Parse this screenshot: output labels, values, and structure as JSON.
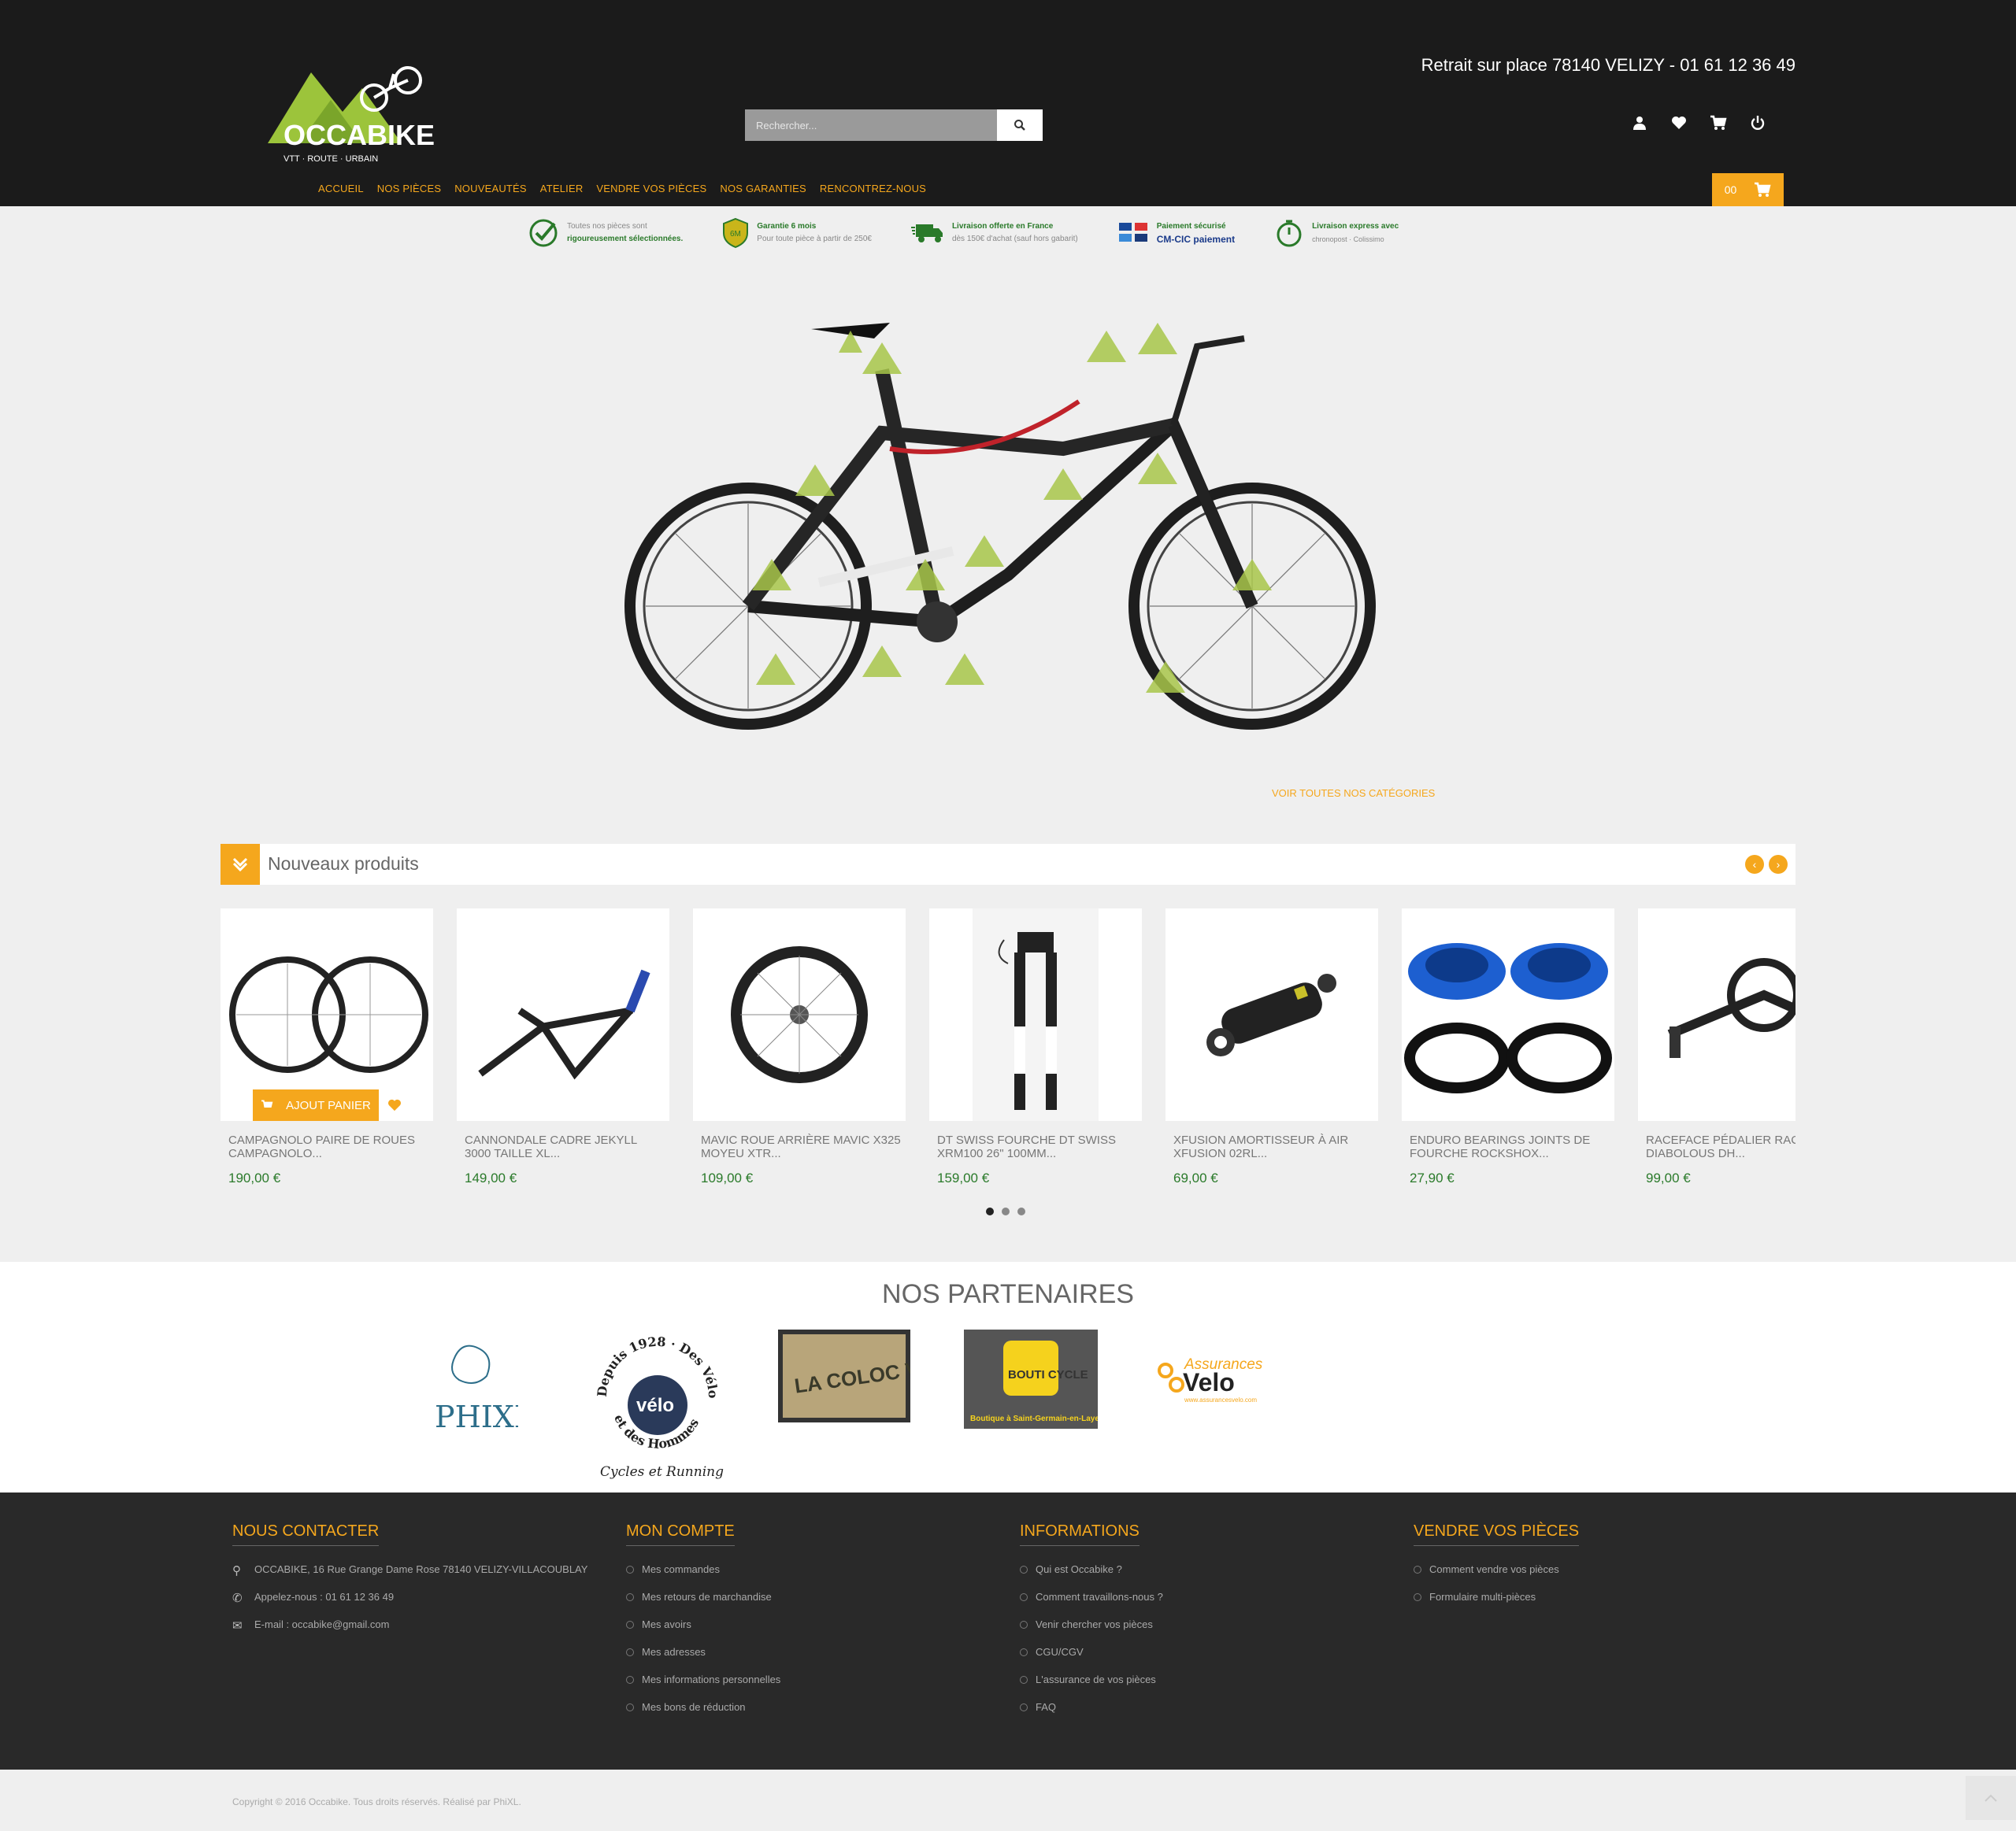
{
  "header": {
    "logo_text": "OCCABIKE",
    "logo_tagline": "VTT · ROUTE · URBAIN",
    "pickup": "Retrait sur place 78140 VELIZY - 01 61 12 36 49",
    "search_placeholder": "Rechercher..."
  },
  "nav": [
    "ACCUEIL",
    "NOS PIÈCES",
    "NOUVEAUTÉS",
    "ATELIER",
    "VENDRE VOS PIÈCES",
    "NOS GARANTIES",
    "RENCONTREZ-NOUS"
  ],
  "cart_count": "00",
  "reassurance": [
    {
      "line1": "Toutes nos pièces sont",
      "line2": "rigoureusement sélectionnées."
    },
    {
      "line1": "Garantie 6 mois",
      "line2": "Pour toute pièce à partir de 250€"
    },
    {
      "line1": "Livraison offerte en France",
      "line2": "dès 150€ d'achat (sauf hors gabarit)"
    },
    {
      "line1": "Paiement sécurisé",
      "line2": "CM-CIC paiement"
    },
    {
      "line1": "Livraison express avec",
      "line2": "chronopost · Colissimo"
    }
  ],
  "all_categories": "VOIR TOUTES NOS CATÉGORIES",
  "new_products": {
    "title": "Nouveaux produits",
    "add_to_cart": "AJOUT PANIER",
    "items": [
      {
        "name": "CAMPAGNOLO PAIRE DE ROUES CAMPAGNOLO...",
        "price": "190,00 €"
      },
      {
        "name": "CANNONDALE CADRE JEKYLL 3000 TAILLE XL...",
        "price": "149,00 €"
      },
      {
        "name": "MAVIC ROUE ARRIÈRE MAVIC X325 MOYEU XTR...",
        "price": "109,00 €"
      },
      {
        "name": "DT SWISS FOURCHE DT SWISS XRM100 26\" 100MM...",
        "price": "159,00 €"
      },
      {
        "name": "XFUSION AMORTISSEUR À AIR XFUSION 02RL...",
        "price": "69,00 €"
      },
      {
        "name": "ENDURO BEARINGS JOINTS DE FOURCHE ROCKSHOX...",
        "price": "27,90 €"
      },
      {
        "name": "RACEFACE PÉDALIER RACEFACE DIABOLOUS DH...",
        "price": "99,00 €"
      }
    ]
  },
  "partners": {
    "title": "NOS PARTENAIRES",
    "phixl": "PHIXL",
    "velo_ring_top": "Depuis 1928 · Des Vélos",
    "velo_ring_bottom": "et des Hommes",
    "velo_center": "vélo",
    "velo_caption": "Cycles et Running",
    "coloc": "LA COLOC VERTE",
    "bouticycle_name": "BOUTI CYCLE",
    "bouticycle_sub": "Boutique à Saint-Germain-en-Laye",
    "assurances_top": "Assurances",
    "assurances_main": "Velo",
    "assurances_url": "www.assurancesvelo.com"
  },
  "footer": {
    "contact": {
      "title": "NOUS CONTACTER",
      "address": "OCCABIKE, 16 Rue Grange Dame Rose 78140 VELIZY-VILLACOUBLAY",
      "phone": "Appelez-nous : 01 61 12 36 49",
      "email": "E-mail : occabike@gmail.com"
    },
    "account": {
      "title": "MON COMPTE",
      "links": [
        "Mes commandes",
        "Mes retours de marchandise",
        "Mes avoirs",
        "Mes adresses",
        "Mes informations personnelles",
        "Mes bons de réduction"
      ]
    },
    "info": {
      "title": "INFORMATIONS",
      "links": [
        "Qui est Occabike ?",
        "Comment travaillons-nous ?",
        "Venir chercher vos pièces",
        "CGU/CGV",
        "L'assurance de vos pièces",
        "FAQ"
      ]
    },
    "sell": {
      "title": "VENDRE VOS PIÈCES",
      "links": [
        "Comment vendre vos pièces",
        "Formulaire multi-pièces"
      ]
    },
    "copyright": "Copyright © 2016 Occabike. Tous droits réservés. Réalisé par PhiXL."
  },
  "colors": {
    "accent": "#f5a71d",
    "green": "#2a7a2a",
    "lime": "#9cc43b",
    "dark": "#1b1b1b"
  }
}
